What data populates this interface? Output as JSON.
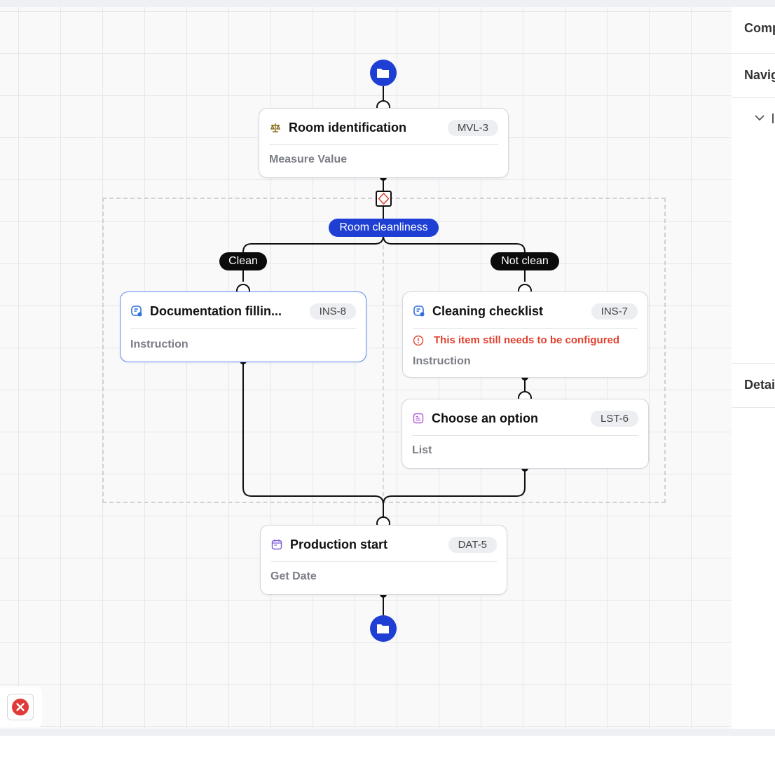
{
  "flow": {
    "condition_label": "Room cleanliness",
    "branches": {
      "left": "Clean",
      "right": "Not clean"
    },
    "nodes": [
      {
        "id": "room",
        "title": "Room identification",
        "code": "MVL-3",
        "type": "Measure Value",
        "icon": "scale-icon",
        "icon_color": "#8a6d1d"
      },
      {
        "id": "doc",
        "title": "Documentation fillin...",
        "code": "INS-8",
        "type": "Instruction",
        "icon": "instruction-icon",
        "icon_color": "#2f6fde",
        "selected": true
      },
      {
        "id": "clean",
        "title": "Cleaning checklist",
        "code": "INS-7",
        "type": "Instruction",
        "icon": "instruction-icon",
        "icon_color": "#2f6fde",
        "warning": "This item still needs to be configured"
      },
      {
        "id": "choose",
        "title": "Choose an option",
        "code": "LST-6",
        "type": "List",
        "icon": "list-icon",
        "icon_color": "#b05ad8"
      },
      {
        "id": "prod",
        "title": "Production start",
        "code": "DAT-5",
        "type": "Get Date",
        "icon": "calendar-icon",
        "icon_color": "#7a5ad8"
      }
    ]
  },
  "side_panel": {
    "sections": [
      "Comp",
      "Navig",
      "Detai"
    ]
  },
  "colors": {
    "accent": "#1f3fd4",
    "warning": "#e0412f",
    "error": "#e03a3a"
  }
}
